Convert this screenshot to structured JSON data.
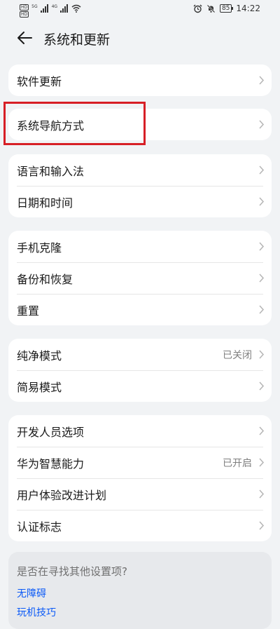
{
  "status_bar": {
    "sim1": "HD",
    "sim2": "HD",
    "net1": "5G",
    "net2": "4G",
    "battery": "85",
    "time": "14:22"
  },
  "header": {
    "title": "系统和更新"
  },
  "groups": [
    {
      "items": [
        {
          "label": "软件更新"
        }
      ]
    },
    {
      "items": [
        {
          "label": "系统导航方式"
        }
      ]
    },
    {
      "items": [
        {
          "label": "语言和输入法"
        },
        {
          "label": "日期和时间"
        }
      ]
    },
    {
      "items": [
        {
          "label": "手机克隆"
        },
        {
          "label": "备份和恢复"
        },
        {
          "label": "重置"
        }
      ]
    },
    {
      "items": [
        {
          "label": "纯净模式",
          "value": "已关闭"
        },
        {
          "label": "简易模式"
        }
      ]
    },
    {
      "items": [
        {
          "label": "开发人员选项"
        },
        {
          "label": "华为智慧能力",
          "value": "已开启"
        },
        {
          "label": "用户体验改进计划"
        },
        {
          "label": "认证标志"
        }
      ]
    }
  ],
  "suggestions": {
    "question": "是否在寻找其他设置项?",
    "links": [
      "无障碍",
      "玩机技巧"
    ]
  },
  "colors": {
    "accent_link": "#0a59f7",
    "highlight_box": "#d71f26",
    "page_background": "#f1f3f5"
  }
}
